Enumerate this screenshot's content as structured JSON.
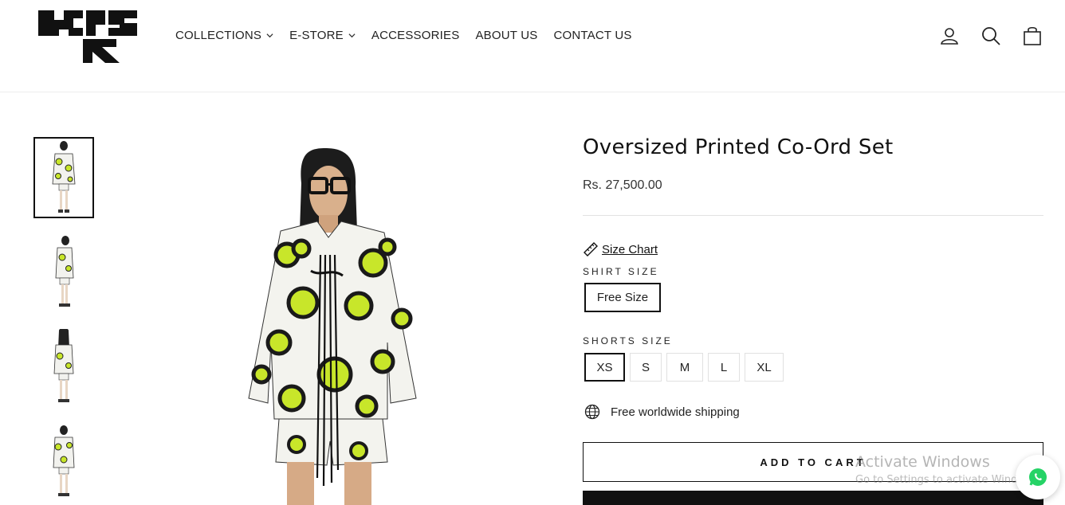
{
  "header": {
    "logo_alt": "brand-logo",
    "nav": [
      {
        "label": "COLLECTIONS",
        "has_dropdown": true
      },
      {
        "label": "E-STORE",
        "has_dropdown": true
      },
      {
        "label": "ACCESSORIES",
        "has_dropdown": false
      },
      {
        "label": "ABOUT US",
        "has_dropdown": false
      },
      {
        "label": "CONTACT US",
        "has_dropdown": false
      }
    ],
    "icons": [
      "account-icon",
      "search-icon",
      "cart-icon"
    ]
  },
  "gallery": {
    "thumbnails": [
      "front-view",
      "side-view",
      "back-view",
      "alt-front-view"
    ],
    "active_index": 0
  },
  "product": {
    "title": "Oversized Printed Co-Ord Set",
    "price": "Rs. 27,500.00",
    "size_chart_label": "Size Chart",
    "shirt_size_label": "SHIRT SIZE",
    "shirt_sizes": [
      "Free Size"
    ],
    "shirt_selected": "Free Size",
    "shorts_size_label": "SHORTS SIZE",
    "shorts_sizes": [
      "XS",
      "S",
      "M",
      "L",
      "XL"
    ],
    "shorts_selected": "XS",
    "shipping_text": "Free worldwide shipping",
    "add_to_cart_label": "ADD TO CART"
  },
  "watermark": {
    "line1": "Activate Windows",
    "line2": "Go to Settings to activate Windows."
  },
  "colors": {
    "accent": "#111111",
    "print_green": "#c8e62a",
    "whatsapp": "#25d366"
  }
}
